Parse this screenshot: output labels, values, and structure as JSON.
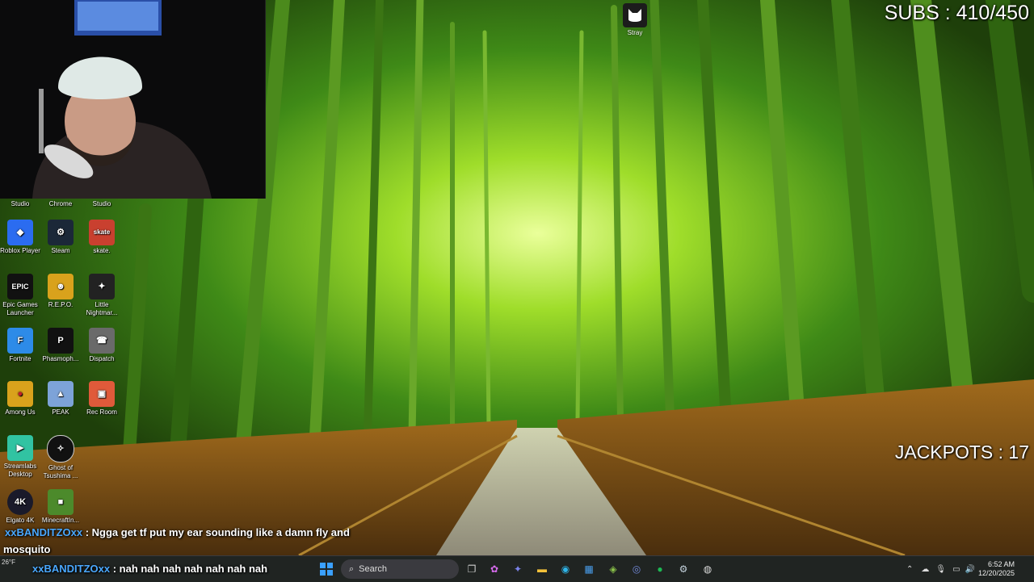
{
  "overlay": {
    "subs": "SUBS : 410/450",
    "jackpots": "JACKPOTS : 17"
  },
  "desktop_icons": [
    {
      "label": "Studio",
      "icon": "studio-icon",
      "color": "#333"
    },
    {
      "label": "Chrome",
      "icon": "chrome-icon",
      "color": "#333"
    },
    {
      "label": "Studio",
      "icon": "studio-icon",
      "color": "#333"
    },
    {
      "label": "Roblox Player",
      "icon": "roblox-icon",
      "color": "#2b6cf0"
    },
    {
      "label": "Steam",
      "icon": "steam-icon",
      "color": "#1b2838"
    },
    {
      "label": "skate.",
      "icon": "skate-icon",
      "color": "#c9402f"
    },
    {
      "label": "Epic Games Launcher",
      "icon": "epic-games-icon",
      "color": "#111"
    },
    {
      "label": "R.E.P.O.",
      "icon": "repo-icon",
      "color": "#d9a21c"
    },
    {
      "label": "Little Nightmar...",
      "icon": "little-nightmares-icon",
      "color": "#222"
    },
    {
      "label": "Fortnite",
      "icon": "fortnite-icon",
      "color": "#2d8be8"
    },
    {
      "label": "Phasmoph...",
      "icon": "phasmophobia-icon",
      "color": "#111"
    },
    {
      "label": "Dispatch",
      "icon": "dispatch-icon",
      "color": "#6a6a6a"
    },
    {
      "label": "Among Us",
      "icon": "among-us-icon",
      "color": "#d9a21c"
    },
    {
      "label": "PEAK",
      "icon": "peak-icon",
      "color": "#7da3d8"
    },
    {
      "label": "Rec Room",
      "icon": "rec-room-icon",
      "color": "#e05a3a"
    },
    {
      "label": "Streamlabs Desktop",
      "icon": "streamlabs-icon",
      "color": "#31c3a2"
    },
    {
      "label": "Ghost of Tsushima ...",
      "icon": "ghost-of-tsushima-icon",
      "color": "#111"
    },
    {
      "label": "Elgato 4K",
      "icon": "elgato-icon",
      "color": "#1a1a2a"
    },
    {
      "label": "MinecraftIn...",
      "icon": "minecraft-icon",
      "color": "#4c8a2b"
    }
  ],
  "stray": {
    "label": "Stray"
  },
  "chat": [
    {
      "user": "xxBANDITZOxx",
      "message": ": Ngga get tf put my ear sounding like a damn fly and",
      "cont": "mosquito"
    },
    {
      "user": "xxBANDITZOxx",
      "message": ": nah nah nah nah nah nah nah"
    }
  ],
  "taskbar": {
    "search_placeholder": "Search",
    "weather": "26°F",
    "time": "6:52 AM",
    "date": "12/20/2025",
    "apps": [
      "start-icon",
      "search-icon",
      "task-view-icon",
      "copilot-icon",
      "teams-icon",
      "file-explorer-icon",
      "edge-icon",
      "store-icon",
      "gaming-icon",
      "discord-icon",
      "spotify-icon",
      "steam-icon",
      "obs-icon"
    ]
  }
}
